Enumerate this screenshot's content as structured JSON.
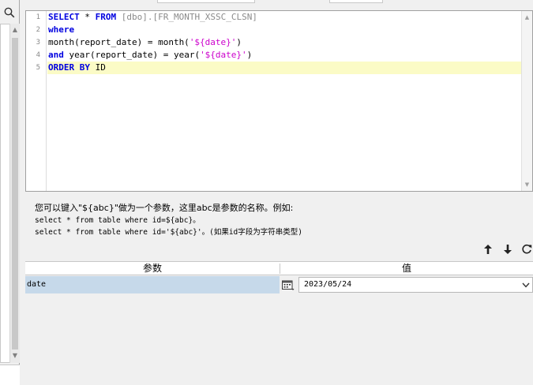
{
  "editor": {
    "line_numbers": [
      "1",
      "2",
      "3",
      "4",
      "5"
    ],
    "lines": [
      {
        "kw1": "SELECT",
        "sp1": " * ",
        "kw2": "FROM",
        "rest": " [dbo].[FR_MONTH_XSSC_CLSN]"
      },
      {
        "kw": "where"
      },
      {
        "fn1": "month(report_date) = month(",
        "str": "'${date}'",
        "end": ")"
      },
      {
        "kw": "and",
        "fn1": " year(report_date) = year(",
        "str": "'${date}'",
        "end": ")"
      },
      {
        "kw1": "ORDER",
        "kw2": "BY",
        "rest": " ID"
      }
    ]
  },
  "help": {
    "line1": "您可以键入\"${abc}\"做为一个参数，这里abc是参数的名称。例如:",
    "line2": "select * from table where id=${abc}。",
    "line3": "select * from table where id='${abc}'。(如果id字段为字符串类型)"
  },
  "params": {
    "header_name": "参数",
    "header_value": "值",
    "rows": [
      {
        "name": "date",
        "value": "2023/05/24"
      }
    ]
  },
  "colors": {
    "keyword": "#0000e0",
    "string": "#cc00cc",
    "active_line": "#fbfbc6",
    "selected_row": "#c6d9ea"
  },
  "icons": [
    "search-icon",
    "arrow-up-icon",
    "arrow-down-icon",
    "refresh-icon",
    "calendar-icon",
    "chevron-down-icon"
  ]
}
